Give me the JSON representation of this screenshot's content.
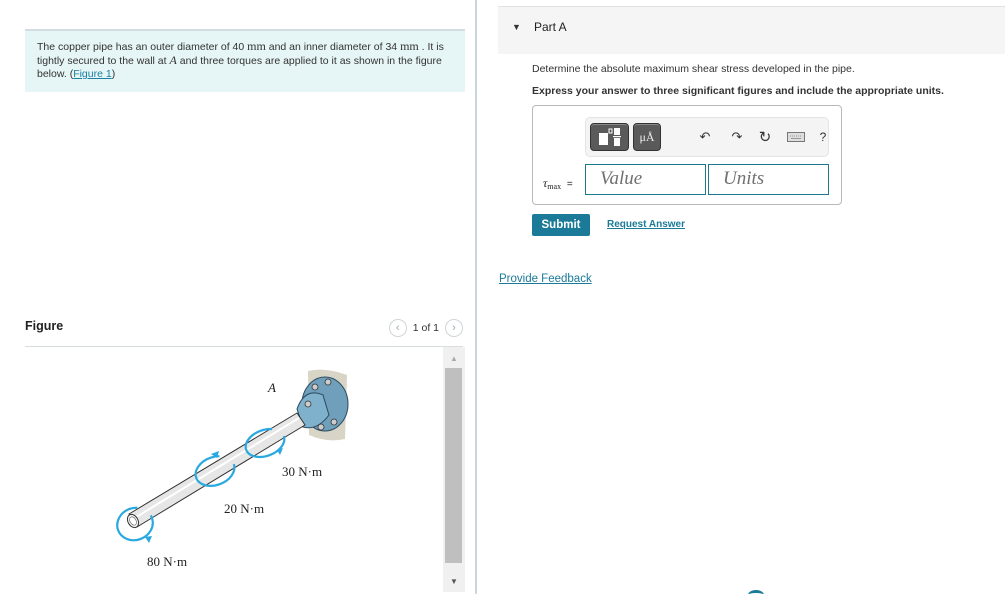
{
  "problem": {
    "text_1": "The copper pipe has an outer diameter of 40 ",
    "unit_1": "mm",
    "text_2": " and an inner diameter of 34 ",
    "unit_2": "mm",
    "text_3": " . It is tightly secured to the wall at ",
    "point": "A",
    "text_4": " and three torques are applied to it as shown in the figure below. (",
    "figure_link": "Figure 1",
    "text_5": ")"
  },
  "figure": {
    "title": "Figure",
    "pager": "1 of 1",
    "prev_icon": "chevron-left",
    "next_icon": "chevron-right",
    "labels": {
      "point": "A",
      "torque_1": "30 N·m",
      "torque_2": "20 N·m",
      "torque_3": "80 N·m"
    },
    "colors": {
      "arrow": "#29a9e0",
      "flange": "#6f9fba",
      "wall": "#d8d4c6",
      "pipe": "#e4e4e4"
    }
  },
  "part": {
    "title": "Part A",
    "question": "Determine the absolute maximum shear stress developed in the pipe.",
    "instruction": "Express your answer to three significant figures and include the appropriate units.",
    "toolbar": {
      "units_button": "μÅ",
      "undo_icon": "undo-arrow",
      "redo_icon": "redo-arrow",
      "reset_icon": "refresh",
      "keyboard_icon": "keyboard",
      "help": "?"
    },
    "variable": "τ",
    "variable_sub": "max",
    "equals": "=",
    "value_placeholder": "Value",
    "units_placeholder": "Units",
    "submit": "Submit",
    "request_answer": "Request Answer"
  },
  "feedback": "Provide Feedback",
  "colors": {
    "accent": "#1a7a98",
    "problem_bg": "#e6f5f5"
  }
}
